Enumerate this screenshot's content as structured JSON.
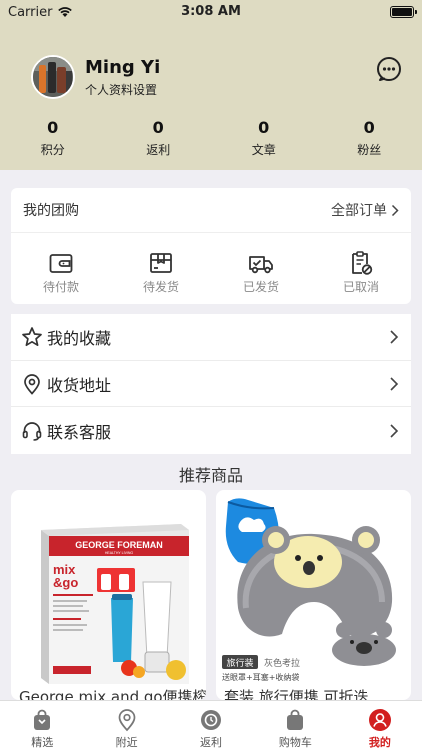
{
  "status_bar": {
    "carrier": "Carrier",
    "time": "3:08 AM"
  },
  "profile": {
    "name": "Ming Yi",
    "subtitle": "个人资料设置"
  },
  "stats": [
    {
      "value": "0",
      "label": "积分"
    },
    {
      "value": "0",
      "label": "返利"
    },
    {
      "value": "0",
      "label": "文章"
    },
    {
      "value": "0",
      "label": "粉丝"
    }
  ],
  "group": {
    "title": "我的团购",
    "all_orders": "全部订单",
    "orders": [
      {
        "label": "待付款",
        "icon": "wallet-icon"
      },
      {
        "label": "待发货",
        "icon": "package-icon"
      },
      {
        "label": "已发货",
        "icon": "truck-icon"
      },
      {
        "label": "已取消",
        "icon": "cancelled-clipboard-icon"
      }
    ]
  },
  "menu": [
    {
      "label": "我的收藏",
      "icon": "star-icon"
    },
    {
      "label": "收货地址",
      "icon": "location-pin-icon"
    },
    {
      "label": "联系客服",
      "icon": "headset-icon"
    }
  ],
  "recommend_title": "推荐商品",
  "products": [
    {
      "title": "George mix and go便携榨",
      "box_brand": "GEORGE FOREMAN",
      "box_tagline": "HEALTHY LIVING",
      "box_name1": "mix",
      "box_name2": "&go"
    },
    {
      "title": "套装 旅行便携 可折迭",
      "tag": "旅行装",
      "caption": "灰色考拉",
      "caption2": "送眼罩+耳塞+收纳袋"
    }
  ],
  "tabs": [
    {
      "label": "精选",
      "icon": "bag-icon"
    },
    {
      "label": "附近",
      "icon": "location-icon"
    },
    {
      "label": "返利",
      "icon": "rebate-icon"
    },
    {
      "label": "购物车",
      "icon": "cart-bag-icon"
    },
    {
      "label": "我的",
      "icon": "user-icon",
      "active": true
    }
  ],
  "colors": {
    "header_bg": "#dedbc2",
    "accent": "#d21f1f",
    "page_bg": "#efeef3"
  }
}
